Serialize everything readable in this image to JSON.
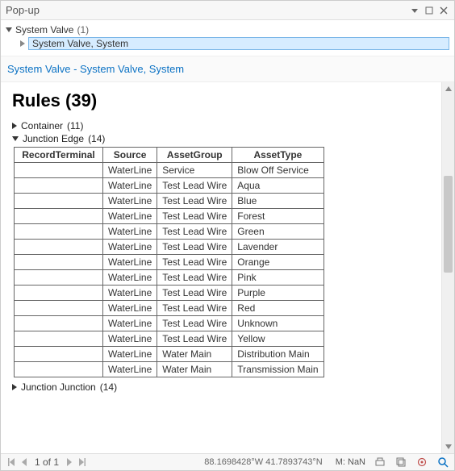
{
  "window": {
    "title": "Pop-up"
  },
  "tree": {
    "root_label": "System Valve",
    "root_count": "(1)",
    "child_label": "System Valve, System"
  },
  "link": {
    "text": "System Valve - System Valve, System"
  },
  "rules": {
    "heading": "Rules (39)",
    "groups": {
      "container": {
        "label": "Container",
        "count": "(11)"
      },
      "junction_edge": {
        "label": "Junction Edge",
        "count": "(14)"
      },
      "junction_junction": {
        "label": "Junction Junction",
        "count": "(14)"
      }
    },
    "columns": [
      "RecordTerminal",
      "Source",
      "AssetGroup",
      "AssetType"
    ],
    "rows": [
      {
        "rt": "",
        "src": "WaterLine",
        "ag": "Service",
        "at": "Blow Off Service"
      },
      {
        "rt": "",
        "src": "WaterLine",
        "ag": "Test Lead Wire",
        "at": "Aqua"
      },
      {
        "rt": "",
        "src": "WaterLine",
        "ag": "Test Lead Wire",
        "at": "Blue"
      },
      {
        "rt": "",
        "src": "WaterLine",
        "ag": "Test Lead Wire",
        "at": "Forest"
      },
      {
        "rt": "",
        "src": "WaterLine",
        "ag": "Test Lead Wire",
        "at": "Green"
      },
      {
        "rt": "",
        "src": "WaterLine",
        "ag": "Test Lead Wire",
        "at": "Lavender"
      },
      {
        "rt": "",
        "src": "WaterLine",
        "ag": "Test Lead Wire",
        "at": "Orange"
      },
      {
        "rt": "",
        "src": "WaterLine",
        "ag": "Test Lead Wire",
        "at": "Pink"
      },
      {
        "rt": "",
        "src": "WaterLine",
        "ag": "Test Lead Wire",
        "at": "Purple"
      },
      {
        "rt": "",
        "src": "WaterLine",
        "ag": "Test Lead Wire",
        "at": "Red"
      },
      {
        "rt": "",
        "src": "WaterLine",
        "ag": "Test Lead Wire",
        "at": "Unknown"
      },
      {
        "rt": "",
        "src": "WaterLine",
        "ag": "Test Lead Wire",
        "at": "Yellow"
      },
      {
        "rt": "",
        "src": "WaterLine",
        "ag": "Water Main",
        "at": "Distribution Main"
      },
      {
        "rt": "",
        "src": "WaterLine",
        "ag": "Water Main",
        "at": "Transmission Main"
      }
    ]
  },
  "status": {
    "page": "1 of 1",
    "coords": "88.1698428°W 41.7893743°N",
    "meta": "M: NaN"
  }
}
